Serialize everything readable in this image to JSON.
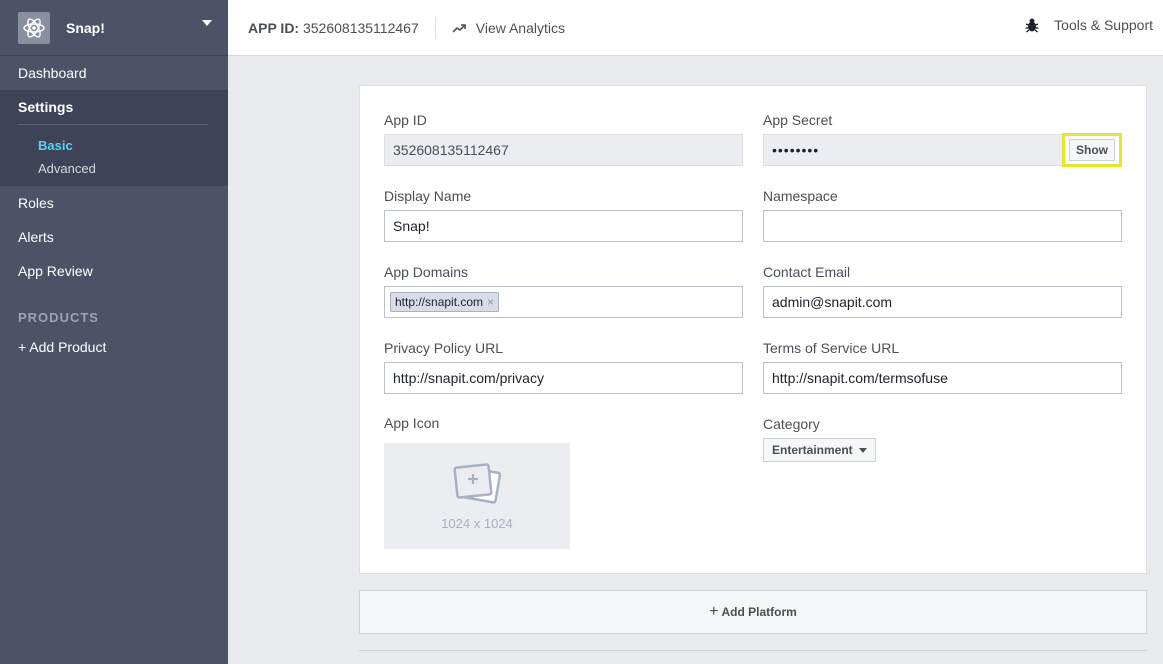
{
  "sidebar": {
    "app_name": "Snap!",
    "items": {
      "dashboard": "Dashboard",
      "settings": "Settings",
      "basic": "Basic",
      "advanced": "Advanced",
      "roles": "Roles",
      "alerts": "Alerts",
      "app_review": "App Review"
    },
    "products_label": "PRODUCTS",
    "add_product": "+ Add Product"
  },
  "topbar": {
    "app_id_label": "APP ID:",
    "app_id_value": "352608135112467",
    "analytics": "View Analytics",
    "tools": "Tools & Support"
  },
  "form": {
    "app_id": {
      "label": "App ID",
      "value": "352608135112467"
    },
    "app_secret": {
      "label": "App Secret",
      "value": "••••••••",
      "show_label": "Show"
    },
    "display_name": {
      "label": "Display Name",
      "value": "Snap!"
    },
    "namespace": {
      "label": "Namespace",
      "value": ""
    },
    "app_domains": {
      "label": "App Domains",
      "token": "http://snapit.com",
      "token_remove": "×"
    },
    "contact_email": {
      "label": "Contact Email",
      "value": "admin@snapit.com"
    },
    "privacy_url": {
      "label": "Privacy Policy URL",
      "value": "http://snapit.com/privacy"
    },
    "tos_url": {
      "label": "Terms of Service URL",
      "value": "http://snapit.com/termsofuse"
    },
    "app_icon": {
      "label": "App Icon",
      "size": "1024 x 1024"
    },
    "category": {
      "label": "Category",
      "value": "Entertainment"
    }
  },
  "platform": {
    "label": "Add Platform"
  },
  "colors": {
    "sidebar_bg": "#4d5266",
    "active_sub": "#5bd3f0",
    "highlight": "#e6e62a"
  }
}
